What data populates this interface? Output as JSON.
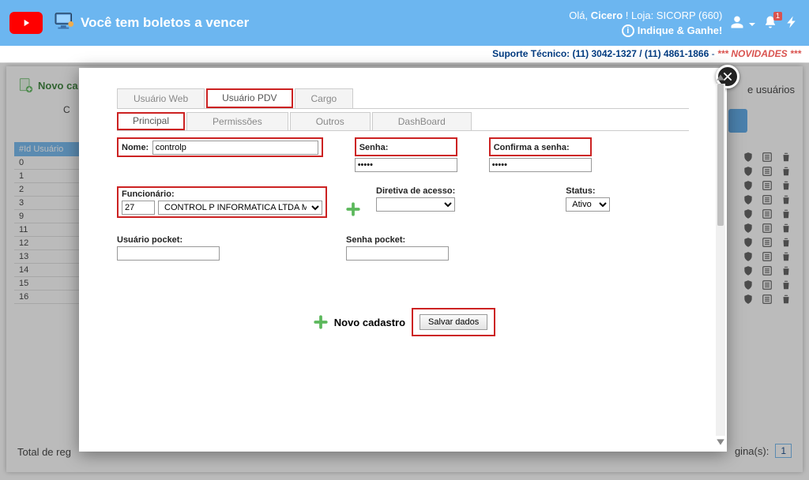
{
  "topbar": {
    "title": "Você tem boletos a vencer",
    "greeting_prefix": "Olá, ",
    "user": "Cicero",
    "greeting_suffix": " ! Loja: SICORP (660)",
    "indique": "Indique & Ganhe!",
    "bell_badge": "1"
  },
  "support": {
    "label": "Suporte Técnico: ",
    "phones": "(11) 3042-1327 / (11) 4861-1866",
    "sep": " - ",
    "stars": "*** ",
    "novidades": "NOVIDADES",
    "stars2": " ***"
  },
  "bg": {
    "novo": "Novo ca",
    "right_label": "e usuários",
    "id_col": "#Id Usuário",
    "rows": [
      "0",
      "1",
      "2",
      "3",
      "9",
      "11",
      "12",
      "13",
      "14",
      "15",
      "16"
    ],
    "footer_left": "Total de reg",
    "footer_right": "gina(s):",
    "page": "1"
  },
  "tabs_top": {
    "web": "Usuário Web",
    "pdv": "Usuário PDV",
    "cargo": "Cargo"
  },
  "tabs_sub": {
    "principal": "Principal",
    "permissoes": "Permissões",
    "outros": "Outros",
    "dashboard": "DashBoard"
  },
  "form": {
    "nome_label": "Nome:",
    "nome_value": "controlp",
    "senha_label": "Senha:",
    "senha_value": "•••••",
    "confirma_label": "Confirma a senha:",
    "confirma_value": "•••••",
    "funcionario_label": "Funcionário:",
    "funcionario_id": "27",
    "funcionario_nome": "CONTROL P INFORMATICA LTDA ME",
    "diretiva_label": "Diretiva de acesso:",
    "status_label": "Status:",
    "status_value": "Ativo",
    "usuario_pocket_label": "Usuário pocket:",
    "senha_pocket_label": "Senha pocket:",
    "novo_cadastro": "Novo cadastro",
    "salvar": "Salvar dados"
  }
}
